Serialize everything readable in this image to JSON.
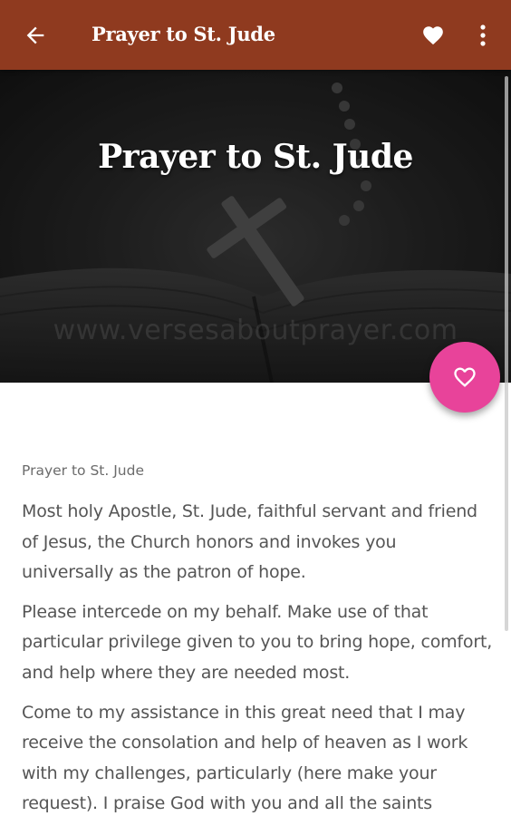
{
  "appbar": {
    "title": "Prayer to St. Jude",
    "icons": {
      "back": "arrow-left-icon",
      "favorite": "heart-icon",
      "menu": "more-vert-icon"
    },
    "color": "#8f3a1f"
  },
  "hero": {
    "title": "Prayer to St. Jude",
    "watermark": "www.versesaboutprayer.com"
  },
  "fab": {
    "icon": "heart-outline-icon",
    "color": "#e8439a"
  },
  "content": {
    "subtitle": "Prayer to St. Jude",
    "paragraphs": [
      "Most holy Apostle, St. Jude, faithful servant and friend of Jesus, the Church honors and invokes you universally as the patron of hope.",
      "Please intercede on my behalf. Make use of that particular privilege given to you to bring hope, comfort, and help where they are needed most.",
      "Come to my assistance in this great need that I may receive the consolation and help of heaven as I work with my challenges, particularly (here make your request). I praise God with you and all the saints"
    ]
  }
}
